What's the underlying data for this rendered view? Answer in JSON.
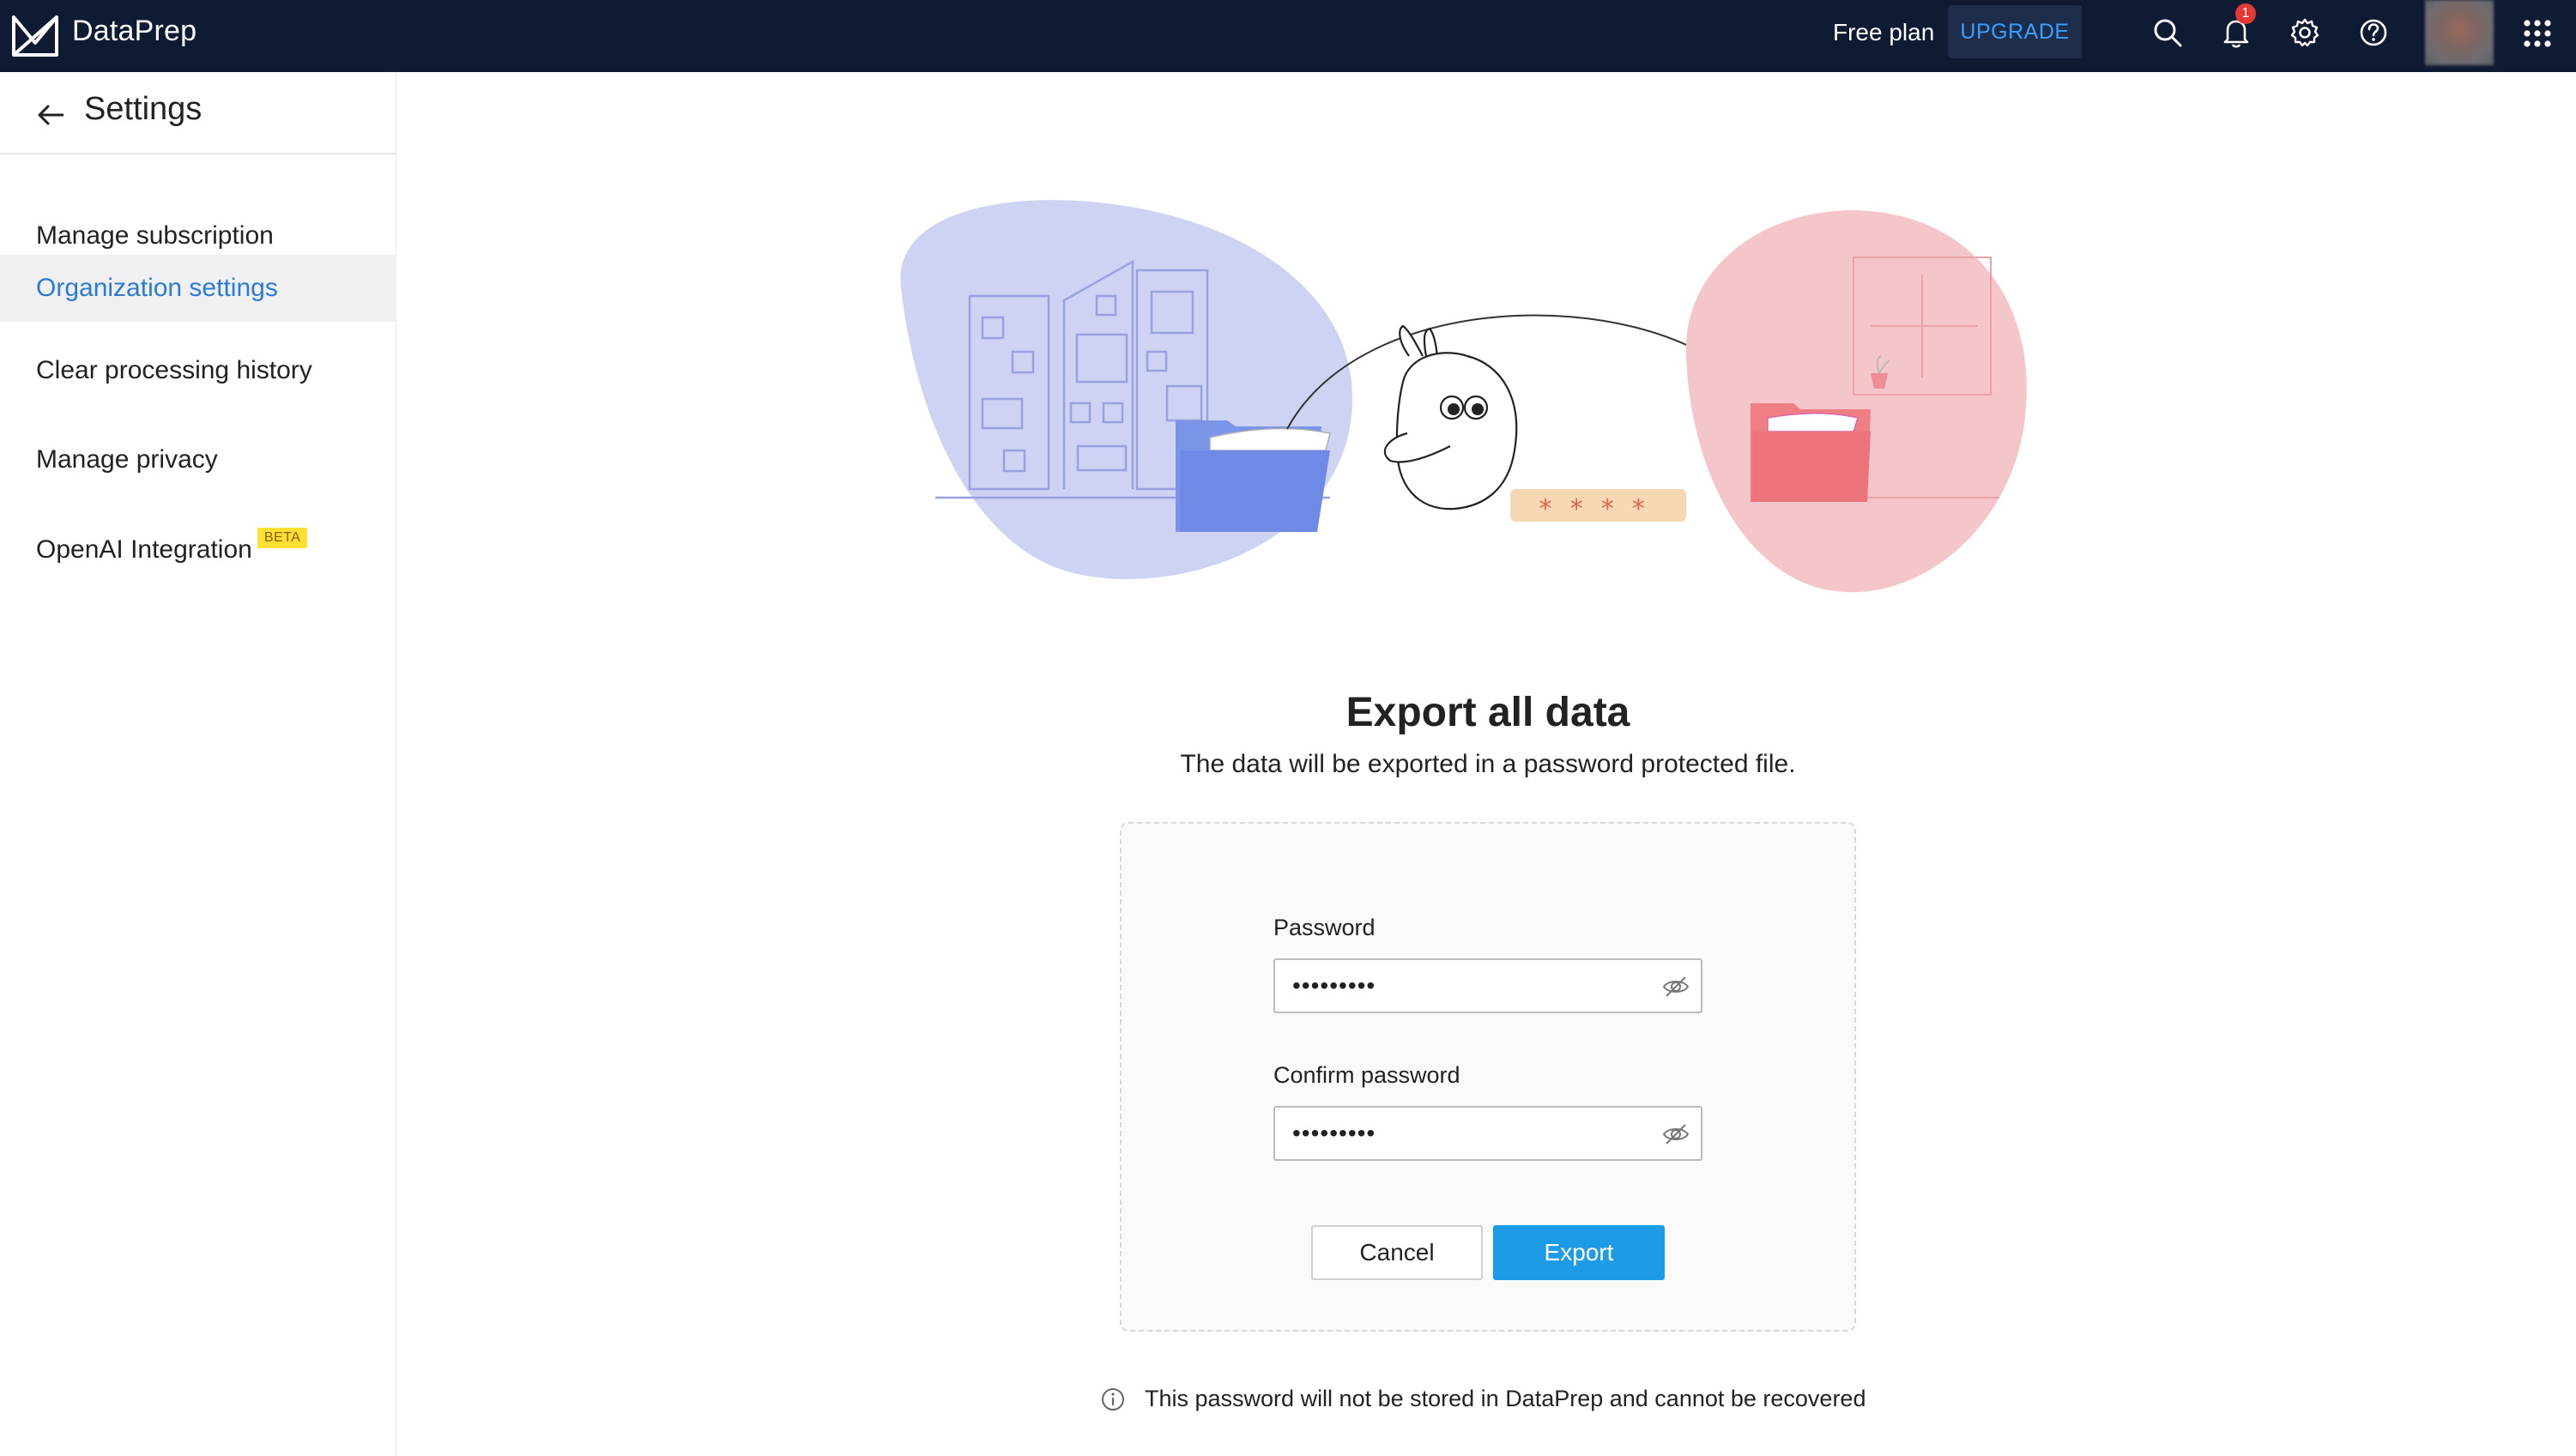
{
  "topbar": {
    "brand": "DataPrep",
    "plan": "Free plan",
    "upgrade_label": "UPGRADE",
    "notification_count": "1",
    "icons": [
      "search-icon",
      "bell-icon",
      "gear-icon",
      "help-icon",
      "avatar",
      "apps-grid-icon"
    ]
  },
  "sidebar": {
    "title": "Settings",
    "items": [
      {
        "label": "Manage subscription",
        "active": false
      },
      {
        "label": "Organization settings",
        "active": true
      },
      {
        "label": "Clear processing history",
        "active": false
      },
      {
        "label": "Manage privacy",
        "active": false
      },
      {
        "label": "OpenAI Integration",
        "badge": "BETA",
        "active": false
      }
    ]
  },
  "main": {
    "title": "Export all data",
    "subtitle": "The data will be exported in a password protected file.",
    "illustration_mask_text": "* * * *",
    "form": {
      "password_label": "Password",
      "password_value": "•••••••••",
      "confirm_label": "Confirm password",
      "confirm_value": "•••••••••",
      "cancel_label": "Cancel",
      "export_label": "Export"
    },
    "note": "This password will not be stored in DataPrep and cannot be recovered"
  },
  "colors": {
    "topbar_bg": "#0f1a33",
    "accent": "#1d9be7",
    "active_link": "#2b7bd6",
    "beta_badge": "#ffe033",
    "notification": "#e53935"
  }
}
